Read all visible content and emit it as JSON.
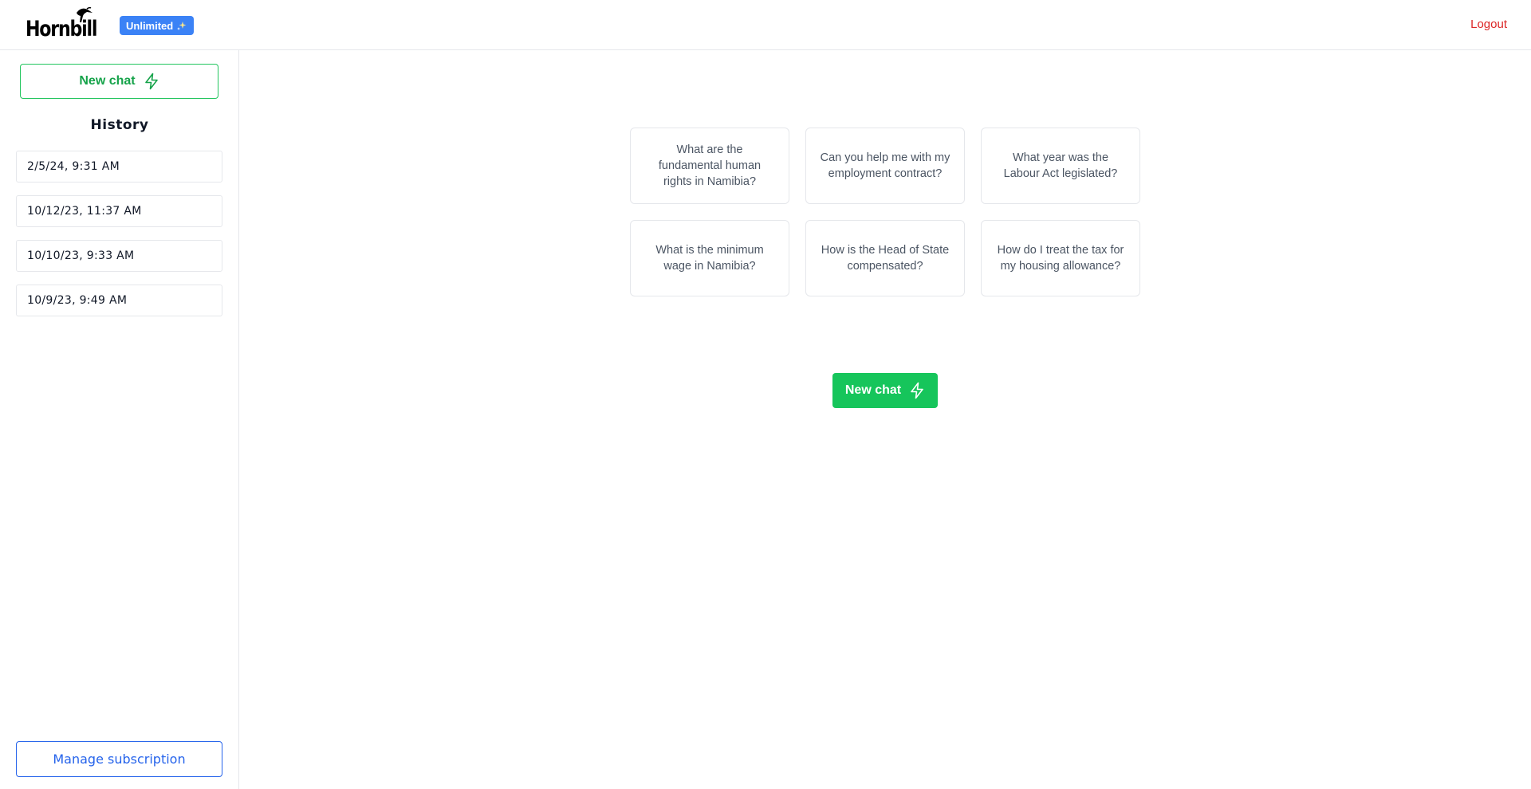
{
  "header": {
    "logo_text": "Hornbill",
    "badge_label": "Unlimited",
    "badge_icon": "sparkles-icon",
    "logout_label": "Logout"
  },
  "sidebar": {
    "new_chat_label": "New chat",
    "new_chat_icon": "lightning-icon",
    "history_title": "History",
    "history_items": [
      "2/5/24, 9:31 AM",
      "10/12/23, 11:37 AM",
      "10/10/23, 9:33 AM",
      "10/9/23, 9:49 AM"
    ],
    "manage_subscription_label": "Manage subscription"
  },
  "main": {
    "prompts": [
      "What are the fundamental human rights in Namibia?",
      "Can you help me with my employment contract?",
      "What year was the Labour Act legislated?",
      "What is the minimum wage in Namibia?",
      "How is the Head of State compensated?",
      "How do I treat the tax for my housing allowance?"
    ],
    "new_chat_label": "New chat"
  },
  "colors": {
    "accent_green": "#16c55b",
    "badge_blue": "#3b82f6",
    "logout_red": "#dc2626",
    "subscription_blue": "#2563eb"
  }
}
